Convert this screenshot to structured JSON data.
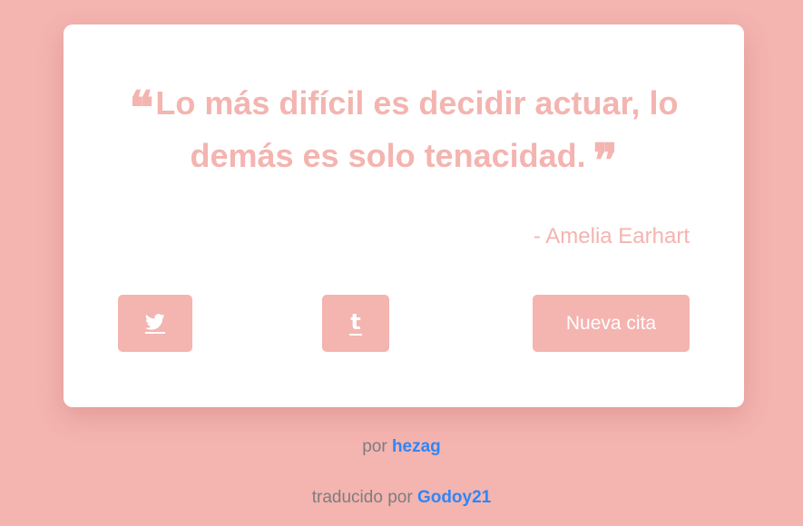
{
  "theme": {
    "background": "#f4b4b0",
    "card": "#ffffff",
    "accent": "#f4b4b0",
    "link": "#2f86f6",
    "muted_text": "#7d7d7d"
  },
  "quote": {
    "open_mark": "❝",
    "text": "Lo más difícil es decidir actuar, lo demás es solo tenacidad.",
    "close_mark": "❞",
    "author": "- Amelia Earhart"
  },
  "buttons": {
    "twitter_icon": "twitter-icon",
    "tumblr_icon": "tumblr-icon",
    "tumblr_glyph": "t",
    "new_quote_label": "Nueva cita"
  },
  "footer": {
    "by_prefix": "por",
    "by_author": "hezag",
    "translated_prefix": "traducido por",
    "translator": "Godoy21"
  }
}
